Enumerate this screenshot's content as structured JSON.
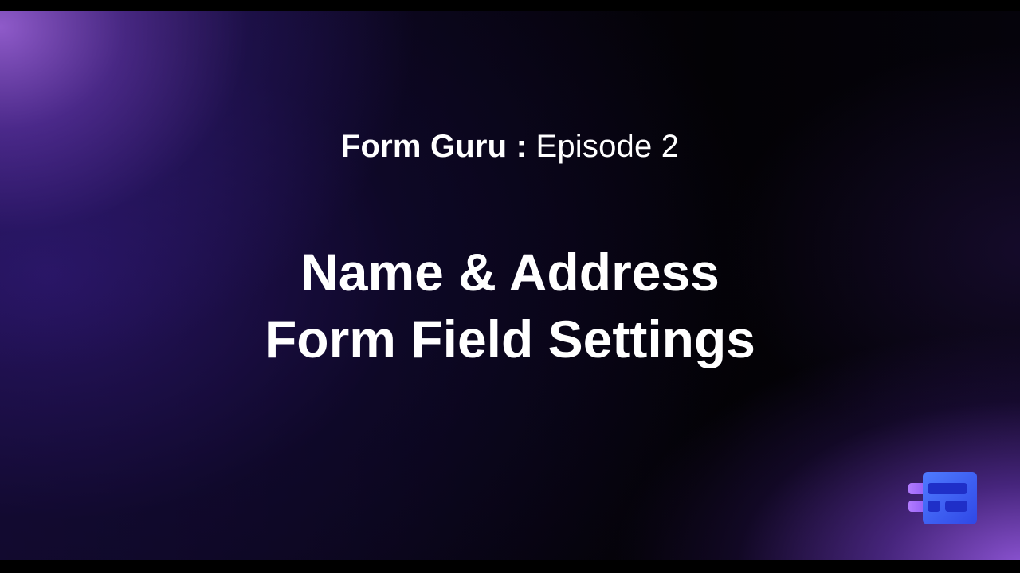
{
  "slide": {
    "subtitle_prefix": "Form Guru :",
    "subtitle_suffix": "Episode 2",
    "title_line_1": "Name & Address",
    "title_line_2": "Form Field Settings"
  },
  "logo": {
    "icon": "form-builder-logo-icon"
  },
  "colors": {
    "background": "#000000",
    "text": "#ffffff",
    "gradient_purple": "#9a5fe0",
    "gradient_indigo": "#2a1670",
    "logo_blue": "#3a57f0",
    "logo_purple": "#9b5cf0"
  }
}
